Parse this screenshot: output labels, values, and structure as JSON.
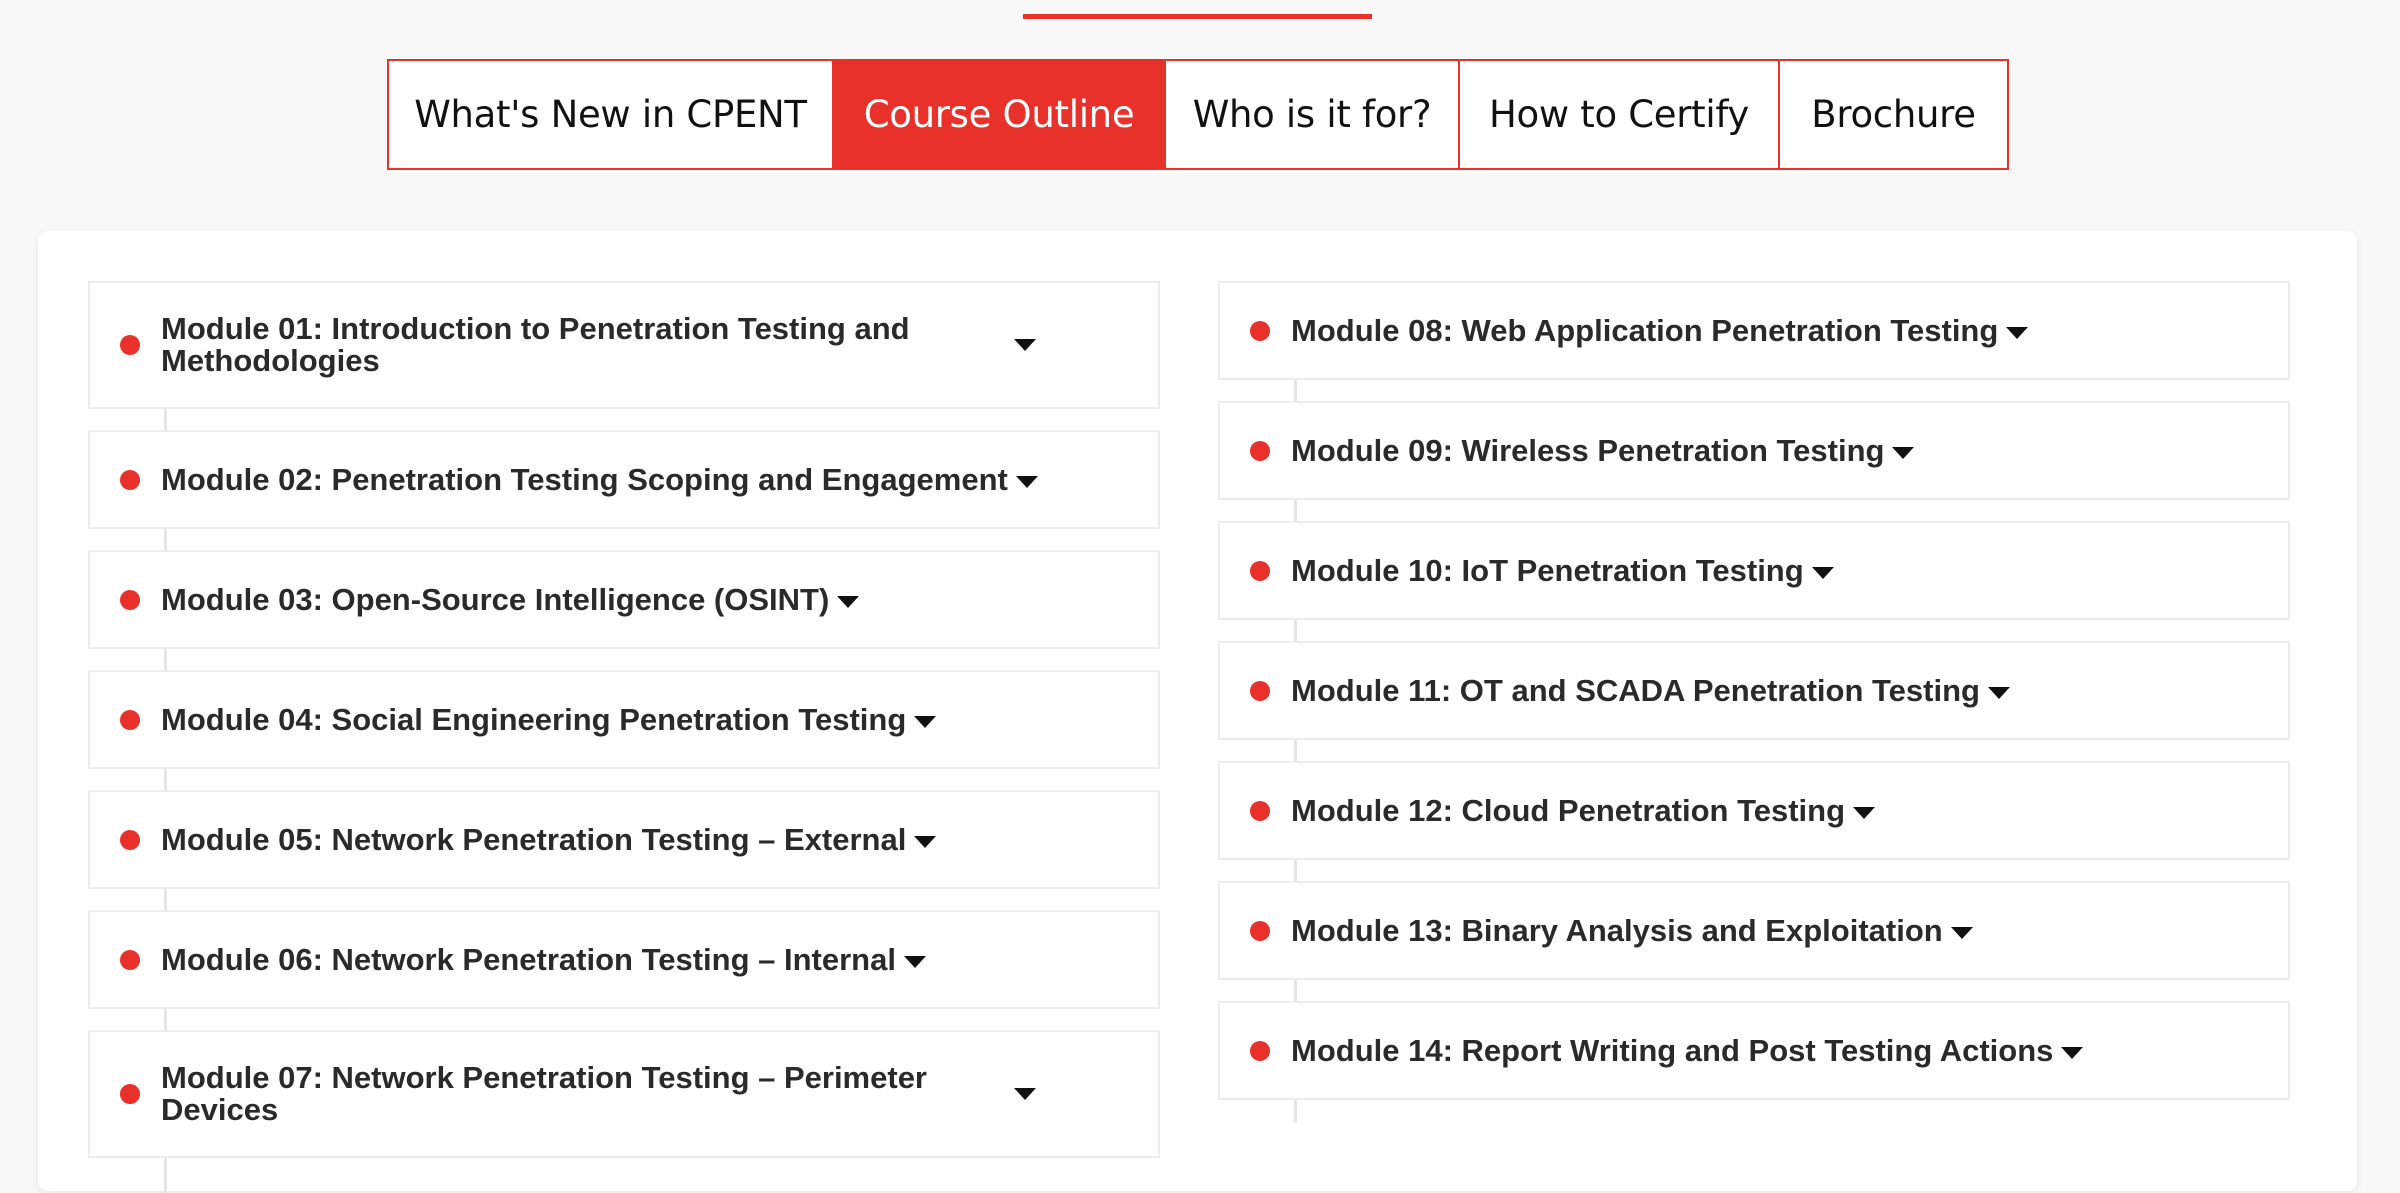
{
  "tabs": [
    {
      "label": "What's New in CPENT",
      "active": false
    },
    {
      "label": "Course Outline",
      "active": true
    },
    {
      "label": "Who is it for?",
      "active": false
    },
    {
      "label": "How to Certify",
      "active": false
    },
    {
      "label": "Brochure",
      "active": false
    }
  ],
  "modules_left": [
    {
      "label": "Module 01: Introduction to Penetration Testing and Methodologies"
    },
    {
      "label": "Module 02: Penetration Testing Scoping and Engagement"
    },
    {
      "label": "Module 03: Open-Source Intelligence (OSINT)"
    },
    {
      "label": "Module 04: Social Engineering Penetration Testing"
    },
    {
      "label": "Module 05: Network Penetration Testing – External"
    },
    {
      "label": "Module 06: Network Penetration Testing – Internal"
    },
    {
      "label": "Module 07: Network Penetration Testing – Perimeter Devices"
    }
  ],
  "modules_right": [
    {
      "label": "Module 08: Web Application Penetration Testing"
    },
    {
      "label": "Module 09: Wireless Penetration Testing"
    },
    {
      "label": "Module 10: IoT Penetration Testing"
    },
    {
      "label": "Module 11: OT and SCADA Penetration Testing"
    },
    {
      "label": "Module 12: Cloud Penetration Testing"
    },
    {
      "label": "Module 13: Binary Analysis and Exploitation"
    },
    {
      "label": "Module 14: Report Writing and Post Testing Actions"
    }
  ],
  "colors": {
    "accent": "#e8312a",
    "text": "#2a2a2a",
    "border": "#ececec"
  },
  "icons": {
    "module_bullet": "red-dot-icon",
    "module_toggle": "caret-down-icon"
  }
}
